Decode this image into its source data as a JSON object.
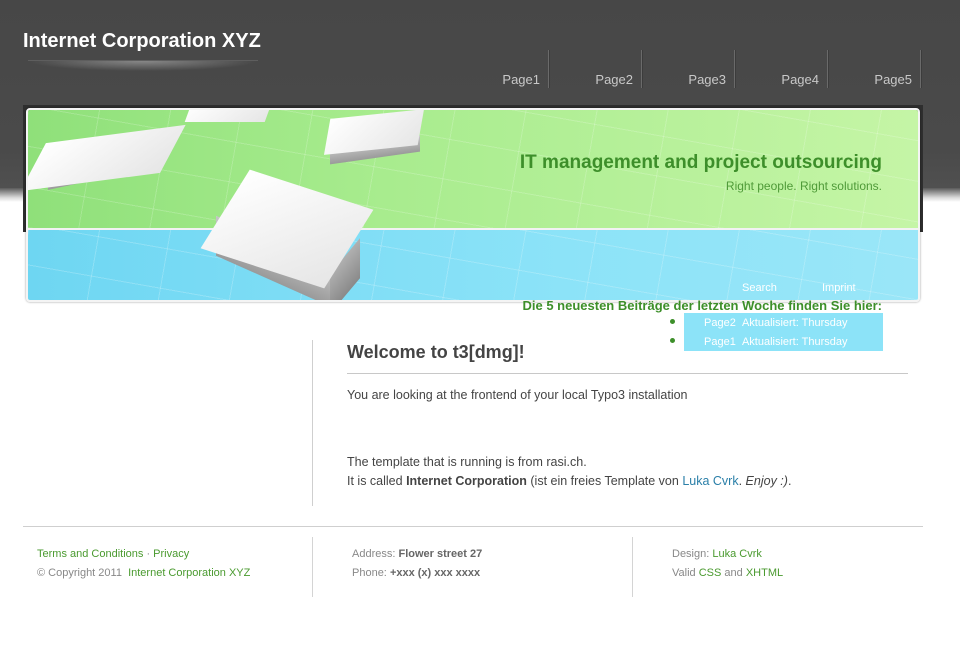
{
  "site": {
    "title": "Internet Corporation XYZ"
  },
  "nav": {
    "items": [
      "Page1",
      "Page2",
      "Page3",
      "Page4",
      "Page5"
    ]
  },
  "banner": {
    "headline": "IT management and project outsourcing",
    "tagline": "Right people. Right solutions.",
    "links": {
      "search": "Search",
      "imprint": "Imprint"
    }
  },
  "latest": {
    "title": "Die 5 neuesten Beiträge der letzten Woche finden Sie hier:",
    "items": [
      {
        "page": "Page2",
        "status": "Aktualisiert: Thursday"
      },
      {
        "page": "Page1",
        "status": "Aktualisiert: Thursday"
      }
    ]
  },
  "main": {
    "heading": "Welcome to t3[dmg]!",
    "para1": "You are looking at the frontend of your local Typo3 installation",
    "para2": "The template that is running is from rasi.ch.",
    "para3": {
      "prefix": "It is called ",
      "bold": "Internet Corporation",
      "middle": " (ist ein freies Template von ",
      "link": "Luka Cvrk",
      "after_link": ". ",
      "italic": "Enjoy :)",
      "end": "."
    }
  },
  "footer": {
    "col1": {
      "terms": "Terms and Conditions",
      "sep": " · ",
      "privacy": "Privacy",
      "copyright": "© Copyright 2011",
      "company": "Internet Corporation XYZ"
    },
    "col2": {
      "address_label": "Address:",
      "address": "Flower street 27",
      "phone_label": "Phone:",
      "phone": "+xxx (x) xxx xxxx"
    },
    "col3": {
      "design_label": "Design:",
      "designer": "Luka Cvrk",
      "valid_label": "Valid",
      "css": "CSS",
      "and": "and",
      "xhtml": "XHTML"
    }
  },
  "colors": {
    "header": "#474747",
    "accent_green": "#3d8f2a",
    "banner_green": "#a8ec8e",
    "banner_blue": "#8ce3f8",
    "link_blue": "#2a7fa8"
  }
}
